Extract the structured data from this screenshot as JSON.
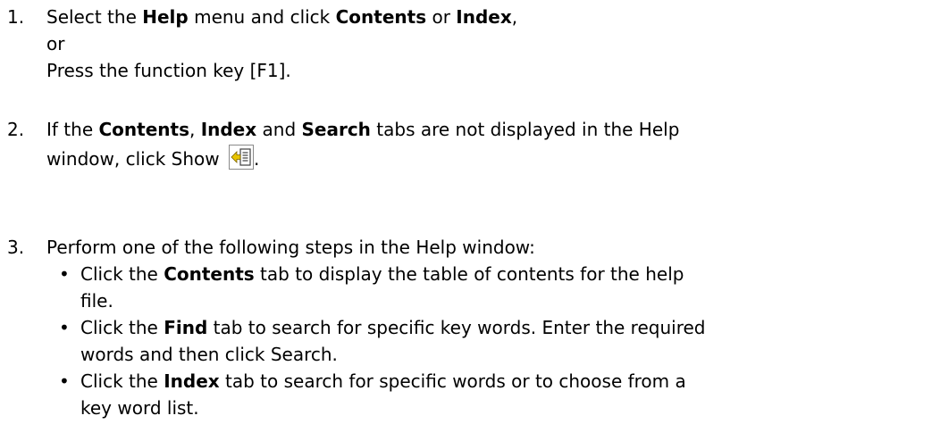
{
  "steps": [
    {
      "number": "1.",
      "line1": {
        "pre": "Select the ",
        "b1": "Help",
        "mid": " menu and click ",
        "b2": "Contents",
        "mid2": " or ",
        "b3": "Index",
        "post": ","
      },
      "line2": "or",
      "line3": "Press the function key [F1]."
    },
    {
      "number": "2.",
      "line1": {
        "pre": "If the ",
        "b1": "Contents",
        "mid": ", ",
        "b2": "Index",
        "mid2": " and ",
        "b3": "Search",
        "post": " tabs are not displayed in the Help"
      },
      "line2": {
        "pre": "window, click Show ",
        "post": "."
      },
      "icon": "show-navigation-pane-icon"
    },
    {
      "number": "3.",
      "line1": "Perform one of the following steps in the Help window:",
      "bullets": [
        {
          "pre": "Click the ",
          "bold": "Contents",
          "post": " tab to display the table of contents for the help",
          "cont": "file."
        },
        {
          "pre": "Click the ",
          "bold": "Find",
          "post": " tab to search for specific key words. Enter the required",
          "cont": "words and then click Search."
        },
        {
          "pre": "Click the ",
          "bold": "Index",
          "post": " tab to search for specific words or to choose from a",
          "cont": "key word list."
        }
      ]
    }
  ],
  "bullet_symbol": "•",
  "colors": {
    "text": "#000000",
    "icon_arrow": "#e8c400",
    "icon_border": "#8a8a8a"
  }
}
